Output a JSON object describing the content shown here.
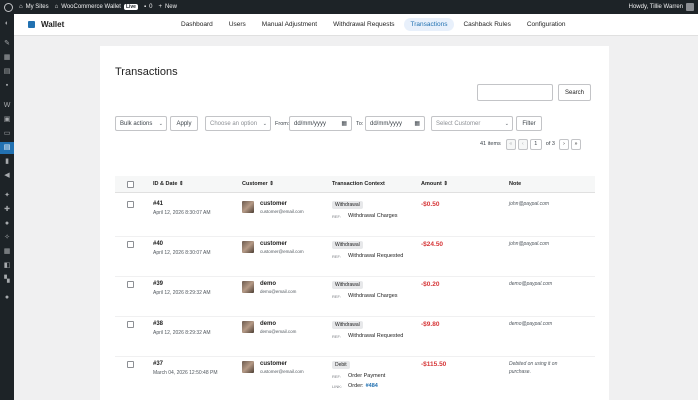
{
  "adminbar": {
    "my_sites": "My Sites",
    "site_name": "WooCommerce Wallet",
    "live": "Live",
    "comments": "0",
    "new": "New",
    "howdy": "Howdy, Tillie Warren"
  },
  "header": {
    "brand": "Wallet",
    "nav": [
      "Dashboard",
      "Users",
      "Manual Adjustment",
      "Withdrawal Requests",
      "Transactions",
      "Cashback Rules",
      "Configuration"
    ],
    "active_tab": "Transactions"
  },
  "page": {
    "title": "Transactions",
    "search_button": "Search",
    "bulk_actions": "Bulk actions",
    "apply": "Apply",
    "choose_option": "Choose an option",
    "from_label": "From:",
    "to_label": "To:",
    "date_placeholder": "dd/mm/yyyy",
    "select_customer": "Select Customer",
    "filter": "Filter",
    "items_count": "41 items",
    "current_page": "1",
    "of_pages": "of 3",
    "pager": {
      "first": "«",
      "prev": "‹",
      "next": "›",
      "last": "»"
    }
  },
  "table": {
    "columns": [
      "ID & Date",
      "Customer",
      "Transaction Context",
      "Amount",
      "Note"
    ],
    "rows": [
      {
        "id": "#41",
        "date": "April 12, 2026 8:30:07 AM",
        "customer": "customer",
        "email": "customer@email.com",
        "type": "Withdrawal",
        "key": "REF:",
        "context": "Withdrawal Charges",
        "amount": "-$0.50",
        "note": "john@paypal.com"
      },
      {
        "id": "#40",
        "date": "April 12, 2026 8:30:07 AM",
        "customer": "customer",
        "email": "customer@email.com",
        "type": "Withdrawal",
        "key": "REF:",
        "context": "Withdrawal Requested",
        "amount": "-$24.50",
        "note": "john@paypal.com"
      },
      {
        "id": "#39",
        "date": "April 12, 2026 8:29:32 AM",
        "customer": "demo",
        "email": "demo@email.com",
        "type": "Withdrawal",
        "key": "REF:",
        "context": "Withdrawal Charges",
        "amount": "-$0.20",
        "note": "demo@paypal.com"
      },
      {
        "id": "#38",
        "date": "April 12, 2026 8:29:32 AM",
        "customer": "demo",
        "email": "demo@email.com",
        "type": "Withdrawal",
        "key": "REF:",
        "context": "Withdrawal Requested",
        "amount": "-$9.80",
        "note": "demo@paypal.com"
      },
      {
        "id": "#37",
        "date": "March 04, 2026 12:50:48 PM",
        "customer": "customer",
        "email": "customer@email.com",
        "type": "Debit",
        "key": "REF:",
        "context": "Order Payment",
        "key2": "LINK:",
        "context2": "Order:",
        "link": "#484",
        "amount": "-$115.50",
        "note": "Debited on using it on purchase."
      }
    ]
  },
  "colors": {
    "accent": "#2271b1",
    "negative": "#d63638",
    "adminbar": "#1d2327"
  }
}
